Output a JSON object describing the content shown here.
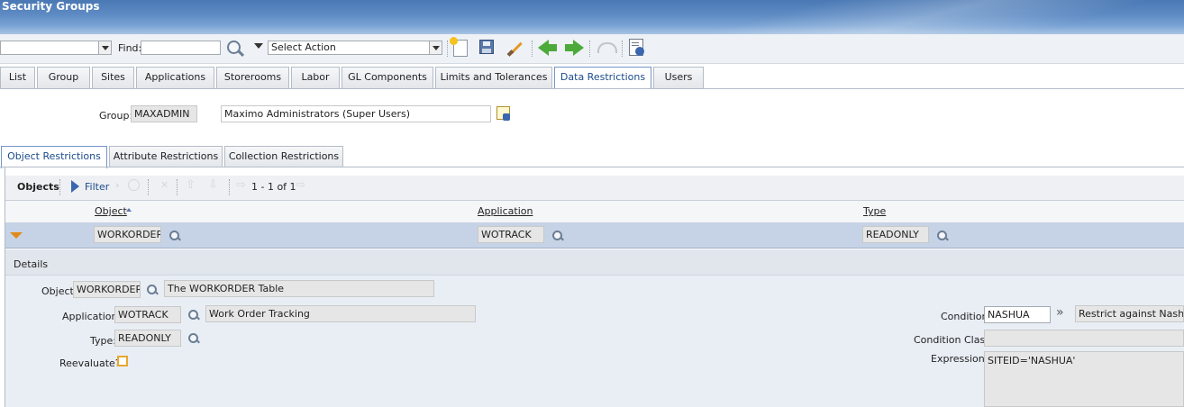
{
  "app": {
    "title": "Security Groups"
  },
  "toolbar": {
    "find_label": "Find:",
    "find_value": "",
    "action_select": "Select Action"
  },
  "tabs": [
    {
      "label": "List"
    },
    {
      "label": "Group"
    },
    {
      "label": "Sites"
    },
    {
      "label": "Applications"
    },
    {
      "label": "Storerooms"
    },
    {
      "label": "Labor"
    },
    {
      "label": "GL Components"
    },
    {
      "label": "Limits and Tolerances"
    },
    {
      "label": "Data Restrictions"
    },
    {
      "label": "Users"
    }
  ],
  "active_tab": "Data Restrictions",
  "group": {
    "label": "Group:",
    "value": "MAXADMIN",
    "description": "Maximo Administrators (Super Users)"
  },
  "subtabs": [
    {
      "label": "Object Restrictions"
    },
    {
      "label": "Attribute Restrictions"
    },
    {
      "label": "Collection Restrictions"
    }
  ],
  "objects_table": {
    "title": "Objects",
    "filter_label": "Filter",
    "pagination": "1 - 1 of 1",
    "columns": [
      "Object",
      "Application",
      "Type"
    ],
    "rows": [
      {
        "object": "WORKORDER",
        "application": "WOTRACK",
        "type": "READONLY"
      }
    ]
  },
  "details": {
    "title": "Details",
    "object_label": "Object:",
    "object_value": "WORKORDER",
    "object_desc": "The WORKORDER Table",
    "application_label": "Application:",
    "application_value": "WOTRACK",
    "application_desc": "Work Order Tracking",
    "type_label": "Type:",
    "type_value": "READONLY",
    "reevaluate_label": "Reevaluate?",
    "condition_label": "Condition:",
    "condition_value": "NASHUA",
    "condition_desc": "Restrict against Nashua",
    "condition_class_label": "Condition Class:",
    "condition_class_value": "",
    "expression_label": "Expression:",
    "expression_value": "SITEID='NASHUA'"
  },
  "colors": {
    "accent": "#1b4b8c",
    "row_selected": "#c6d3e6",
    "details_bg": "#e9eef5"
  }
}
